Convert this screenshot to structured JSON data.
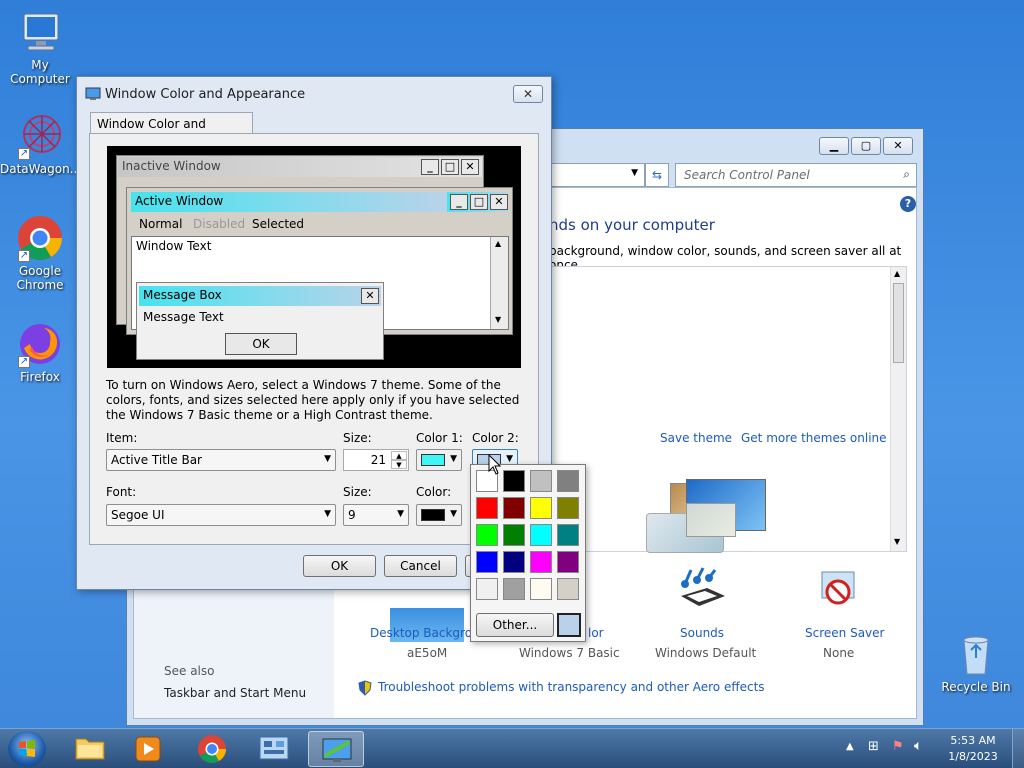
{
  "desktop": {
    "icons": [
      {
        "label": "My Computer"
      },
      {
        "label": "DataWagon..."
      },
      {
        "label": "Google Chrome"
      },
      {
        "label": "Firefox"
      },
      {
        "label": "Recycle Bin"
      }
    ]
  },
  "control_panel": {
    "search_placeholder": "Search Control Panel",
    "heading": "nds on your computer",
    "subheading": "background, window color, sounds, and screen saver all at once.",
    "save_theme": "Save theme",
    "get_more_themes": "Get more themes online",
    "bottom_items": [
      {
        "label": "Desktop Backgroun",
        "value": "aE5oM"
      },
      {
        "label": "lor",
        "value": "Windows 7 Basic"
      },
      {
        "label": "Sounds",
        "value": "Windows Default"
      },
      {
        "label": "Screen Saver",
        "value": "None"
      }
    ],
    "see_also": "See also",
    "taskbar_start_menu": "Taskbar and Start Menu",
    "troubleshoot": "Troubleshoot problems with transparency and other Aero effects"
  },
  "dialog": {
    "title": "Window Color and Appearance",
    "tab_label": "Window Color and Appearance",
    "preview": {
      "inactive_title": "Inactive Window",
      "active_title": "Active Window",
      "menu_normal": "Normal",
      "menu_disabled": "Disabled",
      "menu_selected": "Selected",
      "window_text": "Window Text",
      "msgbox_title": "Message Box",
      "msgbox_text": "Message Text",
      "msgbox_ok": "OK"
    },
    "info_text": "To turn on Windows Aero, select a Windows 7 theme.  Some of the colors, fonts, and sizes selected here apply only if you have selected the Windows 7 Basic theme or a High Contrast theme.",
    "item_label": "Item:",
    "item_value": "Active Title Bar",
    "size_label": "Size:",
    "size_value": "21",
    "color1_label": "Color 1:",
    "color1_value": "#3ff5f5",
    "color2_label": "Color 2:",
    "color2_value": "#b9d1ea",
    "font_label": "Font:",
    "font_value": "Segoe UI",
    "font_size_label": "Size:",
    "font_size_value": "9",
    "font_color_label": "Color:",
    "font_color_value": "#000000",
    "ok": "OK",
    "cancel": "Cancel"
  },
  "palette": {
    "colors": [
      "#ffffff",
      "#000000",
      "#c0c0c0",
      "#808080",
      "#ff0000",
      "#800000",
      "#ffff00",
      "#808000",
      "#00ff00",
      "#008000",
      "#00ffff",
      "#008080",
      "#0000ff",
      "#000080",
      "#ff00ff",
      "#800080",
      "#f0f0f0",
      "#a0a0a0",
      "#fffbf0",
      "#d4d0c8"
    ],
    "other_label": "Other...",
    "current_color": "#b9d1ea"
  },
  "taskbar": {
    "time": "5:53 AM",
    "date": "1/8/2023"
  }
}
